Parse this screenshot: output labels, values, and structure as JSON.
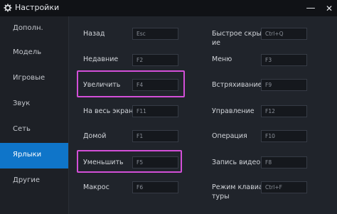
{
  "window": {
    "title": "Настройки",
    "minimize_label": "—",
    "close_label": "✕"
  },
  "sidebar": {
    "items": [
      {
        "label": "Дополн.",
        "active": false
      },
      {
        "label": "Модель",
        "active": false
      },
      {
        "label": "Игровые",
        "active": false
      },
      {
        "label": "Звук",
        "active": false
      },
      {
        "label": "Сеть",
        "active": false
      },
      {
        "label": "Ярлыки",
        "active": true
      },
      {
        "label": "Другие",
        "active": false
      }
    ]
  },
  "shortcuts": {
    "left": [
      {
        "label": "Назад",
        "key": "Esc"
      },
      {
        "label": "Недавние",
        "key": "F2"
      },
      {
        "label": "Увеличить",
        "key": "F4"
      },
      {
        "label": "На весь экран",
        "key": "F11"
      },
      {
        "label": "Домой",
        "key": "F1"
      },
      {
        "label": "Уменьшить",
        "key": "F5"
      },
      {
        "label": "Макрос",
        "key": "F6"
      }
    ],
    "right": [
      {
        "label_line1": "Быстрое скрыт",
        "label_line2": "ие",
        "key": "Ctrl+Q"
      },
      {
        "label_line1": "Меню",
        "label_line2": "",
        "key": "F3"
      },
      {
        "label_line1": "Встряхивание",
        "label_line2": "",
        "key": "F9"
      },
      {
        "label_line1": "Управление",
        "label_line2": "",
        "key": "F12"
      },
      {
        "label_line1": "Операция",
        "label_line2": "",
        "key": "F10"
      },
      {
        "label_line1": "Запись видео",
        "label_line2": "",
        "key": "F8"
      },
      {
        "label_line1": "Режим клавиа",
        "label_line2": "туры",
        "key": "Ctrl+F"
      }
    ]
  },
  "colors": {
    "accent": "#0f75c9",
    "highlight": "#d34fd8"
  },
  "icons": {
    "title": "gear-icon"
  }
}
